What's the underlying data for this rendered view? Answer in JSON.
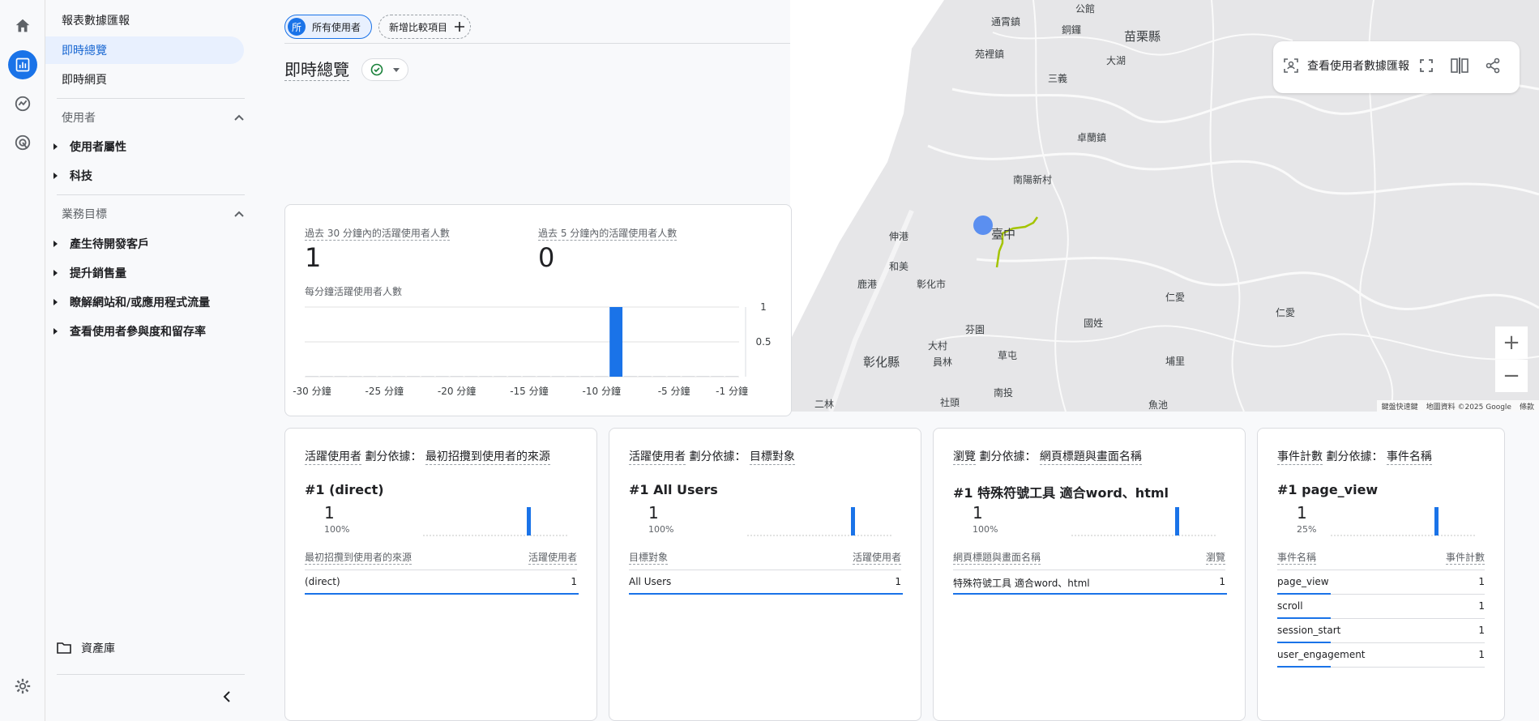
{
  "nav": {
    "top_item": "報表數據匯報",
    "active_item": "即時總覽",
    "item3": "即時網頁",
    "section_users": "使用者",
    "users_sub": [
      "使用者屬性",
      "科技"
    ],
    "section_goals": "業務目標",
    "goals_sub": [
      "產生待開發客戶",
      "提升銷售量",
      "瞭解網站和/或應用程式流量",
      "查看使用者參與度和留存率"
    ],
    "library": "資產庫"
  },
  "header": {
    "chip_all": "所有使用者",
    "chip_all_badge": "所",
    "chip_add": "新增比較項目",
    "title": "即時總覽"
  },
  "toolbar": {
    "user_snapshot": "查看使用者數據匯報"
  },
  "colors": {
    "accent": "#1a73e8",
    "route": "#a4c400"
  },
  "overview": {
    "metric1_label": "過去 30 分鐘內的活躍使用者人數",
    "metric1_value": "1",
    "metric2_label": "過去 5 分鐘內的活躍使用者人數",
    "metric2_value": "0",
    "chart_label": "每分鐘活躍使用者人數"
  },
  "chart_data": {
    "type": "bar",
    "title": "每分鐘活躍使用者人數",
    "x": [
      -30,
      -29,
      -28,
      -27,
      -26,
      -25,
      -24,
      -23,
      -22,
      -21,
      -20,
      -19,
      -18,
      -17,
      -16,
      -15,
      -14,
      -13,
      -12,
      -11,
      -10,
      -9,
      -8,
      -7,
      -6,
      -5,
      -4,
      -3,
      -2,
      -1
    ],
    "values": [
      0,
      0,
      0,
      0,
      0,
      0,
      0,
      0,
      0,
      0,
      0,
      0,
      0,
      0,
      0,
      0,
      0,
      0,
      0,
      0,
      0,
      1,
      0,
      0,
      0,
      0,
      0,
      0,
      0,
      0
    ],
    "tick_labels": [
      "-30 分鐘",
      "-25 分鐘",
      "-20 分鐘",
      "-15 分鐘",
      "-10 分鐘",
      "-5 分鐘",
      "-1 分鐘"
    ],
    "y_tick_labels": [
      "1",
      "0.5"
    ],
    "ylim": [
      0,
      1
    ]
  },
  "map": {
    "labels": [
      "公館",
      "通霄鎮",
      "銅鑼",
      "苗栗縣",
      "苑裡鎮",
      "大湖",
      "三義",
      "卓蘭鎮",
      "南陽新村",
      "伸港",
      "臺中",
      "和美",
      "鹿港",
      "彰化市",
      "仁愛",
      "仁愛",
      "芬園",
      "國姓",
      "大村",
      "員林",
      "草屯",
      "埔里",
      "彰化縣",
      "二林",
      "社頭",
      "南投",
      "魚池"
    ],
    "attribution": [
      "鍵盤快速鍵",
      "地圖資料 ©2025 Google",
      "條款"
    ]
  },
  "cards": [
    {
      "metric": "活躍使用者",
      "by": "劃分依據：",
      "dim": "最初招攬到使用者的來源",
      "top": "#1  (direct)",
      "value": "1",
      "pct": "100%",
      "col_dim": "最初招攬到使用者的來源",
      "col_metric": "活躍使用者",
      "rows": [
        {
          "label": "(direct)",
          "value": "1"
        }
      ]
    },
    {
      "metric": "活躍使用者",
      "by": "劃分依據：",
      "dim": "目標對象",
      "top": "#1  All Users",
      "value": "1",
      "pct": "100%",
      "col_dim": "目標對象",
      "col_metric": "活躍使用者",
      "rows": [
        {
          "label": "All Users",
          "value": "1"
        }
      ]
    },
    {
      "metric": "瀏覽",
      "by": "劃分依據：",
      "dim": "網頁標題與畫面名稱",
      "top": "#1  特殊符號工具 適合word、html",
      "value": "1",
      "pct": "100%",
      "col_dim": "網頁標題與畫面名稱",
      "col_metric": "瀏覽",
      "rows": [
        {
          "label": "特殊符號工具 適合word、html",
          "value": "1"
        }
      ]
    },
    {
      "metric": "事件計數",
      "by": "劃分依據：",
      "dim": "事件名稱",
      "top": "#1  page_view",
      "value": "1",
      "pct": "25%",
      "col_dim": "事件名稱",
      "col_metric": "事件計數",
      "rows": [
        {
          "label": "page_view",
          "value": "1"
        },
        {
          "label": "scroll",
          "value": "1"
        },
        {
          "label": "session_start",
          "value": "1"
        },
        {
          "label": "user_engagement",
          "value": "1"
        }
      ]
    }
  ]
}
